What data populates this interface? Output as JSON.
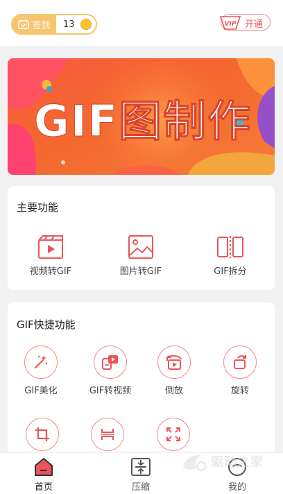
{
  "header": {
    "checkin_label": "签到",
    "checkin_count": "13",
    "vip_badge_text": "VIP",
    "vip_label": "开通"
  },
  "banner": {
    "title": "GIF图制作"
  },
  "main_features": {
    "title": "主要功能",
    "items": [
      {
        "label": "视频转GIF",
        "icon": "video-film-icon"
      },
      {
        "label": "图片转GIF",
        "icon": "image-icon"
      },
      {
        "label": "GIF拆分",
        "icon": "split-icon"
      }
    ]
  },
  "quick_features": {
    "title": "GIF快捷功能",
    "items": [
      {
        "label": "GIF美化",
        "icon": "magic-wand-icon"
      },
      {
        "label": "GIF转视频",
        "icon": "gif-to-video-icon"
      },
      {
        "label": "倒放",
        "icon": "reverse-play-icon"
      },
      {
        "label": "旋转",
        "icon": "rotate-icon"
      },
      {
        "label": "",
        "icon": "crop-icon"
      },
      {
        "label": "",
        "icon": "compress-vertical-icon"
      },
      {
        "label": "",
        "icon": "expand-icon"
      }
    ]
  },
  "bottom_nav": {
    "items": [
      {
        "label": "首页",
        "icon": "home-icon",
        "active": true
      },
      {
        "label": "压缩",
        "icon": "compress-icon",
        "active": false
      },
      {
        "label": "我的",
        "icon": "profile-icon",
        "active": false
      }
    ]
  },
  "watermark": {
    "text": "驱动之家"
  },
  "colors": {
    "accent": "#e9555a",
    "gold": "#f6c56f",
    "banner_orange": "#f26b3a",
    "page_bg": "#f2f2f2"
  }
}
